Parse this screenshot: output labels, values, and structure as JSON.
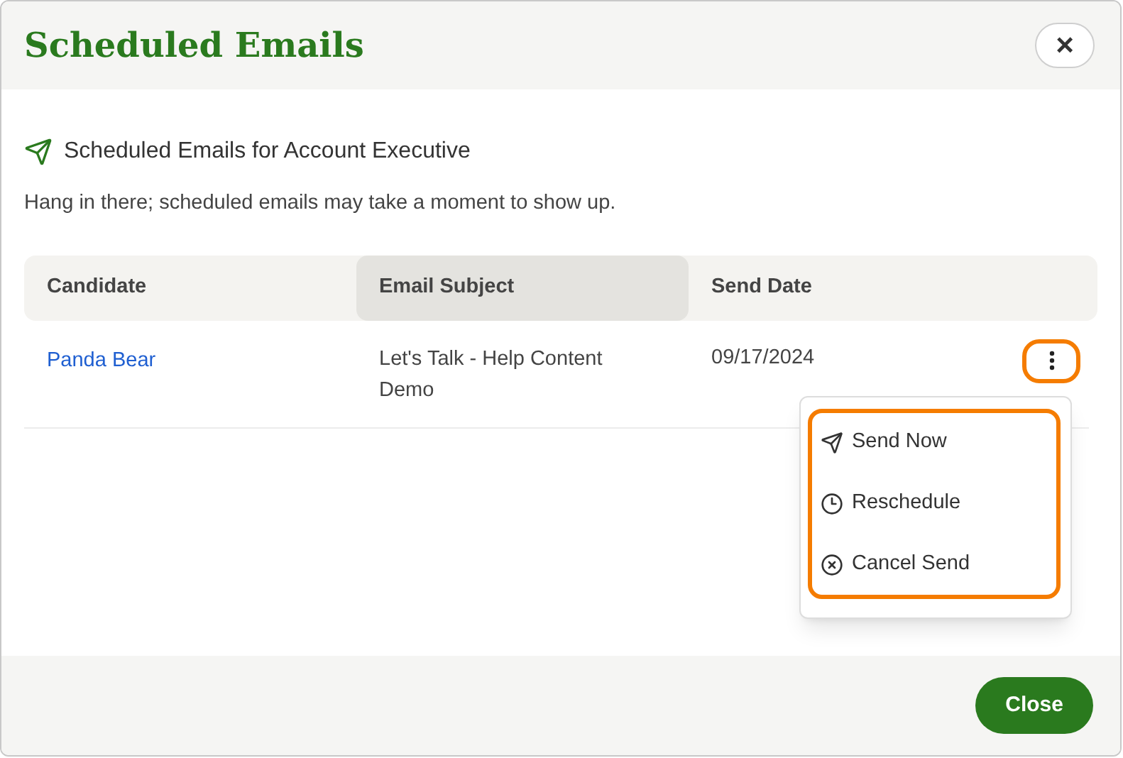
{
  "dialog": {
    "title": "Scheduled Emails",
    "close_label": "×"
  },
  "section": {
    "heading": "Scheduled Emails for Account Executive",
    "note": "Hang in there; scheduled emails may take a moment to show up."
  },
  "table": {
    "columns": [
      {
        "label": "Candidate",
        "selected": false
      },
      {
        "label": "Email Subject",
        "selected": true
      },
      {
        "label": "Send Date",
        "selected": false
      }
    ],
    "rows": [
      {
        "candidate": "Panda Bear",
        "subject": "Let's Talk - Help Content Demo",
        "send_date": "09/17/2024",
        "menu_open": true
      }
    ]
  },
  "menu": {
    "items": [
      {
        "label": "Send Now",
        "kind": "send"
      },
      {
        "label": "Reschedule",
        "kind": "clock"
      },
      {
        "label": "Cancel Send",
        "kind": "cancel"
      }
    ]
  },
  "footer": {
    "button": "Close"
  }
}
